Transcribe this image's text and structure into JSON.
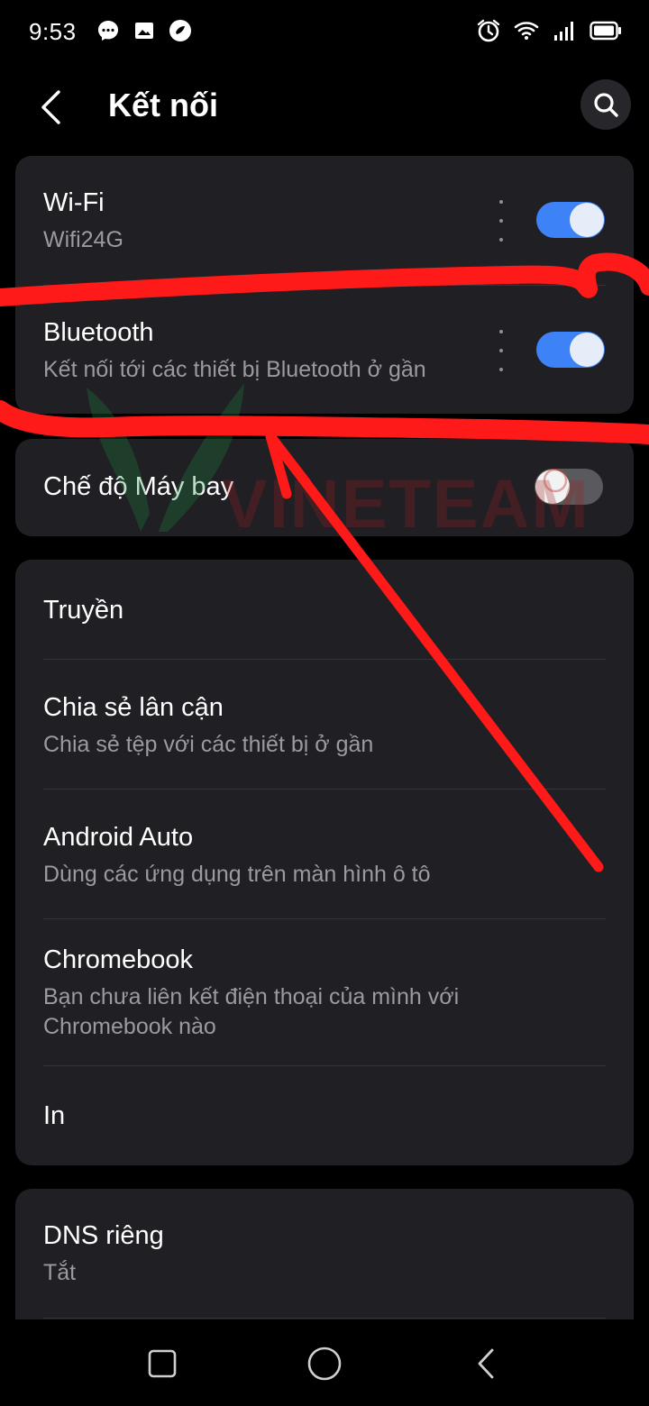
{
  "status_bar": {
    "time": "9:53",
    "left_icons": [
      "messenger-icon",
      "gallery-icon",
      "app-notification-icon"
    ],
    "right_icons": [
      "alarm-icon",
      "wifi-icon",
      "signal-icon",
      "battery-icon"
    ]
  },
  "header": {
    "title": "Kết nối",
    "back_icon": "back-arrow-icon",
    "search_icon": "search-icon"
  },
  "cards": [
    {
      "items": [
        {
          "title": "Wi-Fi",
          "subtitle": "Wifi24G",
          "toggle": true,
          "more": true
        },
        {
          "title": "Bluetooth",
          "subtitle": "Kết nối tới các thiết bị Bluetooth ở gần",
          "toggle": true,
          "more": true
        }
      ]
    },
    {
      "items": [
        {
          "title": "Chế độ Máy bay",
          "toggle": false
        }
      ]
    },
    {
      "items": [
        {
          "title": "Truyền"
        },
        {
          "title": "Chia sẻ lân cận",
          "subtitle": "Chia sẻ tệp với các thiết bị ở gần"
        },
        {
          "title": "Android Auto",
          "subtitle": "Dùng các ứng dụng trên màn hình ô tô"
        },
        {
          "title": "Chromebook",
          "subtitle": "Bạn chưa liên kết điện thoại của mình với Chromebook nào"
        },
        {
          "title": "In"
        }
      ]
    },
    {
      "items": [
        {
          "title": "DNS riêng",
          "subtitle": "Tắt"
        }
      ]
    }
  ],
  "watermark": {
    "text": "VINETEAM"
  },
  "colors": {
    "background": "#000000",
    "card": "#1f1f24",
    "toggle_on": "#3e82f7",
    "annotation_red": "#ff1a1a",
    "secondary_text": "#9a9aa0"
  },
  "nav_bar": [
    "recents-square-icon",
    "home-circle-icon",
    "back-chevron-icon"
  ]
}
